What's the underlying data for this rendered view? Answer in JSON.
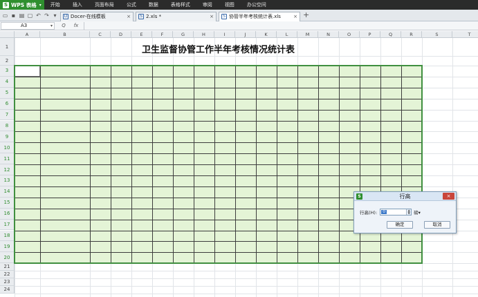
{
  "app": {
    "logo_label": "WPS 表格",
    "logo_icon": "S",
    "menu": [
      "开始",
      "插入",
      "页面布局",
      "公式",
      "数据",
      "表格样式",
      "审阅",
      "视图",
      "办公空间"
    ]
  },
  "tabs": [
    {
      "label": "Docer-在线模板",
      "icon": "D",
      "close": "×",
      "active": false
    },
    {
      "label": "2.xls *",
      "icon": "S",
      "close": "×",
      "active": false
    },
    {
      "label": "协管半年考核统计表.xls",
      "icon": "S",
      "close": "×",
      "active": true
    }
  ],
  "new_tab_symbol": "+",
  "formula_bar": {
    "cell_ref": "A3",
    "zoom_symbol": "Q",
    "fx_label": "fx"
  },
  "sheet": {
    "columns": [
      "A",
      "B",
      "C",
      "D",
      "E",
      "F",
      "G",
      "H",
      "I",
      "J",
      "K",
      "L",
      "M",
      "N",
      "O",
      "P",
      "Q",
      "R",
      "S",
      "T"
    ],
    "rows": [
      "1",
      "2",
      "3",
      "4",
      "5",
      "6",
      "7",
      "8",
      "9",
      "10",
      "11",
      "12",
      "13",
      "14",
      "15",
      "16",
      "17",
      "18",
      "19",
      "20",
      "21",
      "22",
      "23",
      "24"
    ],
    "title": "卫生监督协管工作半年考核情况统计表",
    "selected_rows": [
      3,
      4,
      5,
      6,
      7,
      8,
      9,
      10,
      11,
      12,
      13,
      14,
      15,
      16,
      17,
      18,
      19,
      20
    ],
    "accent_color": "#3f8f3f",
    "table_fill_color": "#e4f4d6"
  },
  "dialog": {
    "title": "行高",
    "close_symbol": "×",
    "label": "行高(H):",
    "value": "0",
    "unit": "磅▾",
    "ok": "确定",
    "cancel": "取消"
  }
}
